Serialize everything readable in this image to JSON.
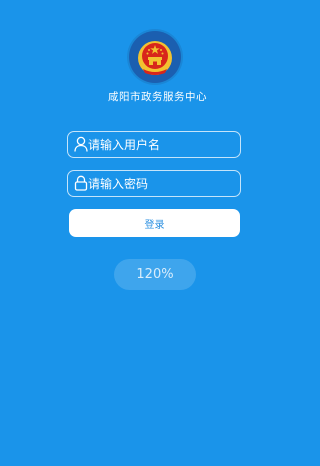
{
  "header": {
    "emblem_icon": "national-emblem-icon",
    "title": "咸阳市政务服务中心"
  },
  "login_form": {
    "username": {
      "icon": "user-icon",
      "placeholder": "请输入用户名",
      "value": ""
    },
    "password": {
      "icon": "lock-icon",
      "placeholder": "请输入密码",
      "value": ""
    },
    "submit_label": "登录"
  },
  "zoom": {
    "level": "120%"
  },
  "colors": {
    "background": "#1a94ea",
    "emblem_ring": "#1b5fb0",
    "emblem_red": "#d8261b",
    "emblem_gold": "#f2c230",
    "button_bg": "#ffffff",
    "button_text": "#2a8fe0"
  }
}
